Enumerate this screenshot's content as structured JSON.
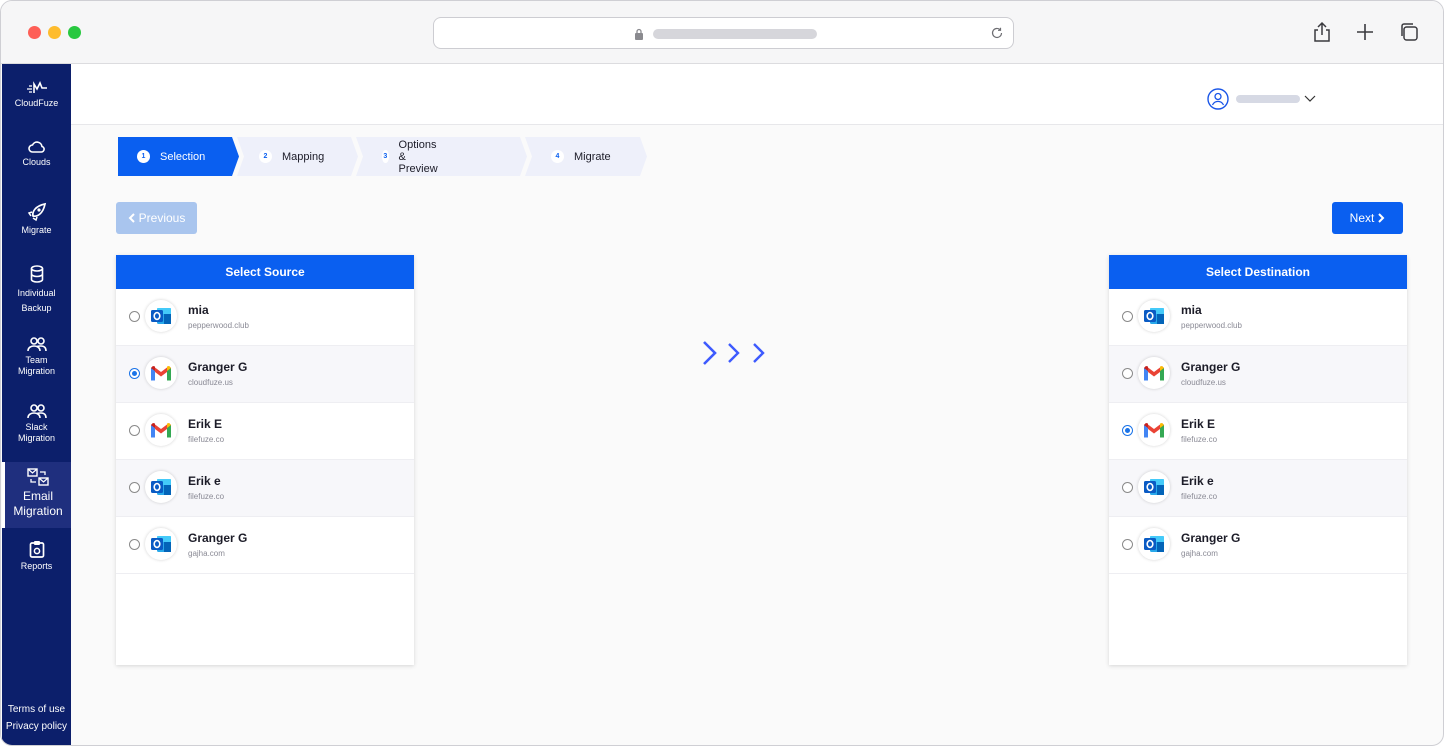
{
  "sidebar": {
    "brand": "CloudFuze",
    "items": [
      {
        "label": "Clouds",
        "icon": "cloud-icon"
      },
      {
        "label": "Migrate",
        "icon": "rocket-icon"
      },
      {
        "label": "Individual Backup",
        "icon": "database-icon"
      },
      {
        "label": "Team Migration",
        "icon": "users-icon"
      },
      {
        "label": "Slack Migration",
        "icon": "users-icon"
      },
      {
        "label": "Email Migration",
        "icon": "email-swap-icon"
      },
      {
        "label": "Reports",
        "icon": "clipboard-icon"
      }
    ],
    "footer": {
      "terms": "Terms of use",
      "privacy": "Privacy policy"
    }
  },
  "stepper": [
    {
      "num": "1",
      "label": "Selection",
      "active": true
    },
    {
      "num": "2",
      "label": "Mapping",
      "active": false
    },
    {
      "num": "3",
      "label": "Options & Preview",
      "active": false
    },
    {
      "num": "4",
      "label": "Migrate",
      "active": false
    }
  ],
  "buttons": {
    "previous": "Previous",
    "next": "Next"
  },
  "source": {
    "title": "Select Source",
    "accounts": [
      {
        "name": "mia",
        "domain": "pepperwood.club",
        "provider": "outlook-icon",
        "selected": false
      },
      {
        "name": "Granger G",
        "domain": "cloudfuze.us",
        "provider": "gmail-icon",
        "selected": true
      },
      {
        "name": "Erik E",
        "domain": "filefuze.co",
        "provider": "gmail-icon",
        "selected": false
      },
      {
        "name": "Erik e",
        "domain": "filefuze.co",
        "provider": "outlook-icon",
        "selected": false
      },
      {
        "name": "Granger G",
        "domain": "gajha.com",
        "provider": "outlook-icon",
        "selected": false
      }
    ]
  },
  "destination": {
    "title": "Select Destination",
    "accounts": [
      {
        "name": "mia",
        "domain": "pepperwood.club",
        "provider": "outlook-icon",
        "selected": false
      },
      {
        "name": "Granger G",
        "domain": "cloudfuze.us",
        "provider": "gmail-icon",
        "selected": false
      },
      {
        "name": "Erik E",
        "domain": "filefuze.co",
        "provider": "gmail-icon",
        "selected": true
      },
      {
        "name": "Erik e",
        "domain": "filefuze.co",
        "provider": "outlook-icon",
        "selected": false
      },
      {
        "name": "Granger G",
        "domain": "gajha.com",
        "provider": "outlook-icon",
        "selected": false
      }
    ]
  },
  "colors": {
    "primary": "#0a5ff0",
    "sidebar": "#0c1f6b",
    "disabled": "#a9c5ee",
    "arrow": "#3d5afe"
  }
}
